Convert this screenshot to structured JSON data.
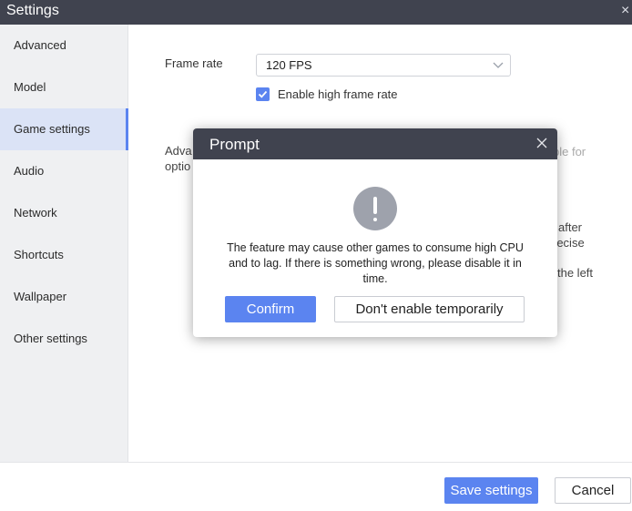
{
  "window": {
    "title": "Settings",
    "close_glyph": "×"
  },
  "sidebar": {
    "items": [
      {
        "label": "Advanced"
      },
      {
        "label": "Model"
      },
      {
        "label": "Game settings",
        "active": true
      },
      {
        "label": "Audio"
      },
      {
        "label": "Network"
      },
      {
        "label": "Shortcuts"
      },
      {
        "label": "Wallpaper"
      },
      {
        "label": "Other settings"
      }
    ]
  },
  "game_settings": {
    "frame_rate_label": "Frame rate",
    "frame_rate_value": "120 FPS",
    "high_frame_rate_label": "Enable high frame rate",
    "high_frame_rate_checked": true,
    "advanced_label_partial_1": "Adva",
    "advanced_label_partial_2": "optio",
    "obscured_right_1": "ple for",
    "obscured_right_2": "after",
    "obscured_right_3": "recise",
    "obscured_right_4": "the left"
  },
  "footer": {
    "save_label": "Save settings",
    "cancel_label": "Cancel"
  },
  "prompt": {
    "title": "Prompt",
    "message": "The feature may cause other games to consume high CPU and to lag. If there is something wrong, please disable it in time.",
    "confirm_label": "Confirm",
    "decline_label": "Don't enable temporarily",
    "icon": "exclamation-icon"
  },
  "colors": {
    "accent": "#5b84f0",
    "titlebar": "#40434f",
    "sidebar_bg": "#eff0f2",
    "active_bg": "#dbe3f6"
  }
}
